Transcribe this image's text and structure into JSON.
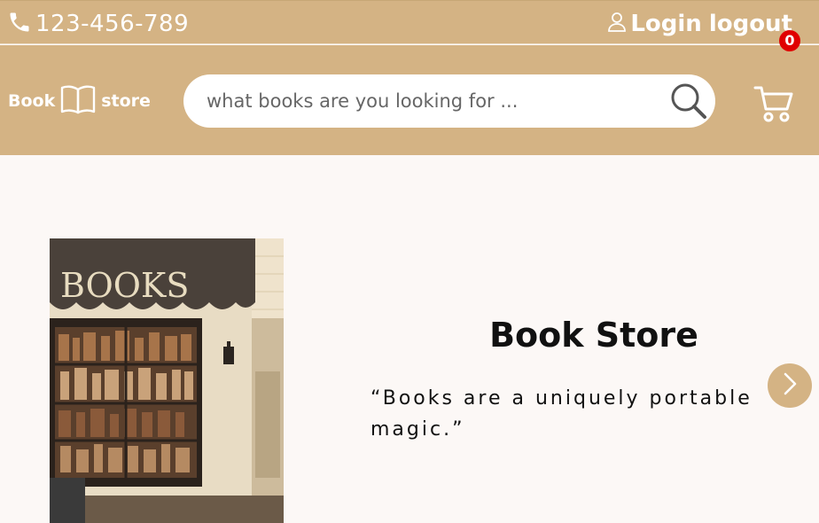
{
  "topbar": {
    "phone": "123-456-789",
    "login_label": "Login",
    "logout_label": "logout"
  },
  "header": {
    "logo_left": "Book",
    "logo_right": "store",
    "search_placeholder": "what books are you looking for ...",
    "cart_count": "0"
  },
  "hero": {
    "image_sign": "BOOKS",
    "title": "Book Store",
    "quote": "“Books are a uniquely portable magic.”"
  },
  "colors": {
    "accent": "#d4b384",
    "background": "#fcf8f6",
    "badge": "#e00000"
  },
  "icons": [
    "phone-icon",
    "user-icon",
    "book-icon",
    "search-icon",
    "cart-icon",
    "chevron-right-icon"
  ]
}
